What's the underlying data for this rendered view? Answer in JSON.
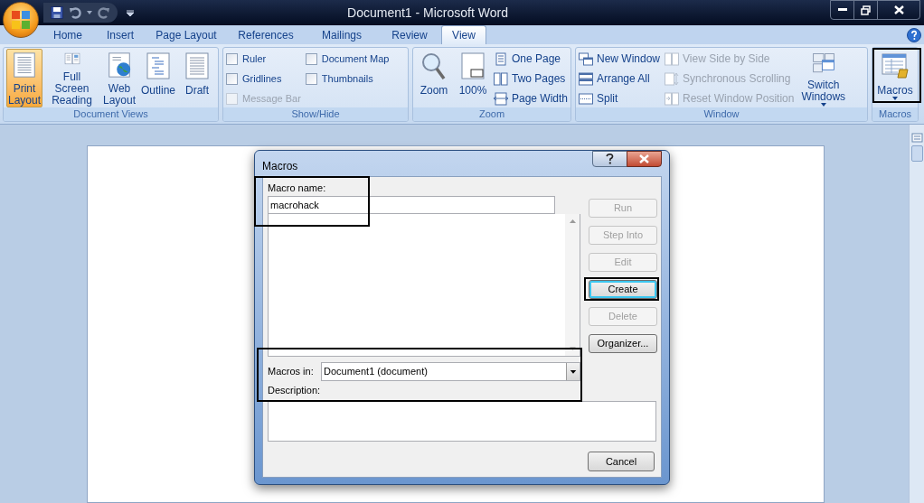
{
  "window": {
    "title": "Document1 - Microsoft Word"
  },
  "ribbon_tabs": [
    {
      "label": "Home",
      "selected": false
    },
    {
      "label": "Insert",
      "selected": false
    },
    {
      "label": "Page Layout",
      "selected": false
    },
    {
      "label": "References",
      "selected": false
    },
    {
      "label": "Mailings",
      "selected": false
    },
    {
      "label": "Review",
      "selected": false
    },
    {
      "label": "View",
      "selected": true
    }
  ],
  "ribbon_groups": [
    {
      "title": "Document Views",
      "items": [
        {
          "kind": "large",
          "label": "Print\nLayout",
          "selected": true
        },
        {
          "kind": "large",
          "label": "Full Screen\nReading",
          "selected": false
        },
        {
          "kind": "large",
          "label": "Web\nLayout",
          "selected": false
        },
        {
          "kind": "large",
          "label": "Outline",
          "selected": false
        },
        {
          "kind": "large",
          "label": "Draft",
          "selected": false
        }
      ]
    },
    {
      "title": "Show/Hide",
      "items": [
        {
          "kind": "column",
          "items": [
            {
              "kind": "checkbox",
              "label": "Ruler",
              "checked": false,
              "disabled": false
            },
            {
              "kind": "checkbox",
              "label": "Gridlines",
              "checked": false,
              "disabled": false
            },
            {
              "kind": "checkbox",
              "label": "Message Bar",
              "checked": false,
              "disabled": true
            }
          ]
        },
        {
          "kind": "column",
          "items": [
            {
              "kind": "checkbox",
              "label": "Document Map",
              "checked": false,
              "disabled": false
            },
            {
              "kind": "checkbox",
              "label": "Thumbnails",
              "checked": false,
              "disabled": false
            }
          ]
        }
      ]
    },
    {
      "title": "Zoom",
      "items": [
        {
          "kind": "large",
          "label": "Zoom"
        },
        {
          "kind": "large",
          "label": "100%"
        },
        {
          "kind": "column",
          "items": [
            {
              "kind": "small",
              "label": "One Page",
              "disabled": false
            },
            {
              "kind": "small",
              "label": "Two Pages",
              "disabled": false
            },
            {
              "kind": "small",
              "label": "Page Width",
              "disabled": false
            }
          ]
        }
      ]
    },
    {
      "title": "Window",
      "items": [
        {
          "kind": "column",
          "items": [
            {
              "kind": "small",
              "label": "New Window",
              "disabled": false
            },
            {
              "kind": "small",
              "label": "Arrange All",
              "disabled": false
            },
            {
              "kind": "small",
              "label": "Split",
              "disabled": false
            }
          ]
        },
        {
          "kind": "column",
          "items": [
            {
              "kind": "small",
              "label": "View Side by Side",
              "disabled": true
            },
            {
              "kind": "small",
              "label": "Synchronous Scrolling",
              "disabled": true
            },
            {
              "kind": "small",
              "label": "Reset Window Position",
              "disabled": true
            }
          ]
        },
        {
          "kind": "large",
          "label": "Switch\nWindows",
          "dropdown": true
        }
      ]
    },
    {
      "title": "Macros",
      "items": [
        {
          "kind": "large",
          "label": "Macros",
          "dropdown": true
        }
      ]
    }
  ],
  "dialog": {
    "title": "Macros",
    "macro_name_label": "Macro name:",
    "macro_name_value": "macrohack",
    "macros_in_label": "Macros in:",
    "macros_in_value": "Document1 (document)",
    "description_label": "Description:",
    "buttons": [
      {
        "label": "Run",
        "disabled": true,
        "focused": false
      },
      {
        "label": "Step Into",
        "disabled": true,
        "focused": false
      },
      {
        "label": "Edit",
        "disabled": true,
        "focused": false
      },
      {
        "label": "Create",
        "disabled": false,
        "focused": true
      },
      {
        "label": "Delete",
        "disabled": true,
        "focused": false
      },
      {
        "label": "Organizer...",
        "disabled": false,
        "focused": false
      }
    ],
    "cancel": "Cancel"
  }
}
